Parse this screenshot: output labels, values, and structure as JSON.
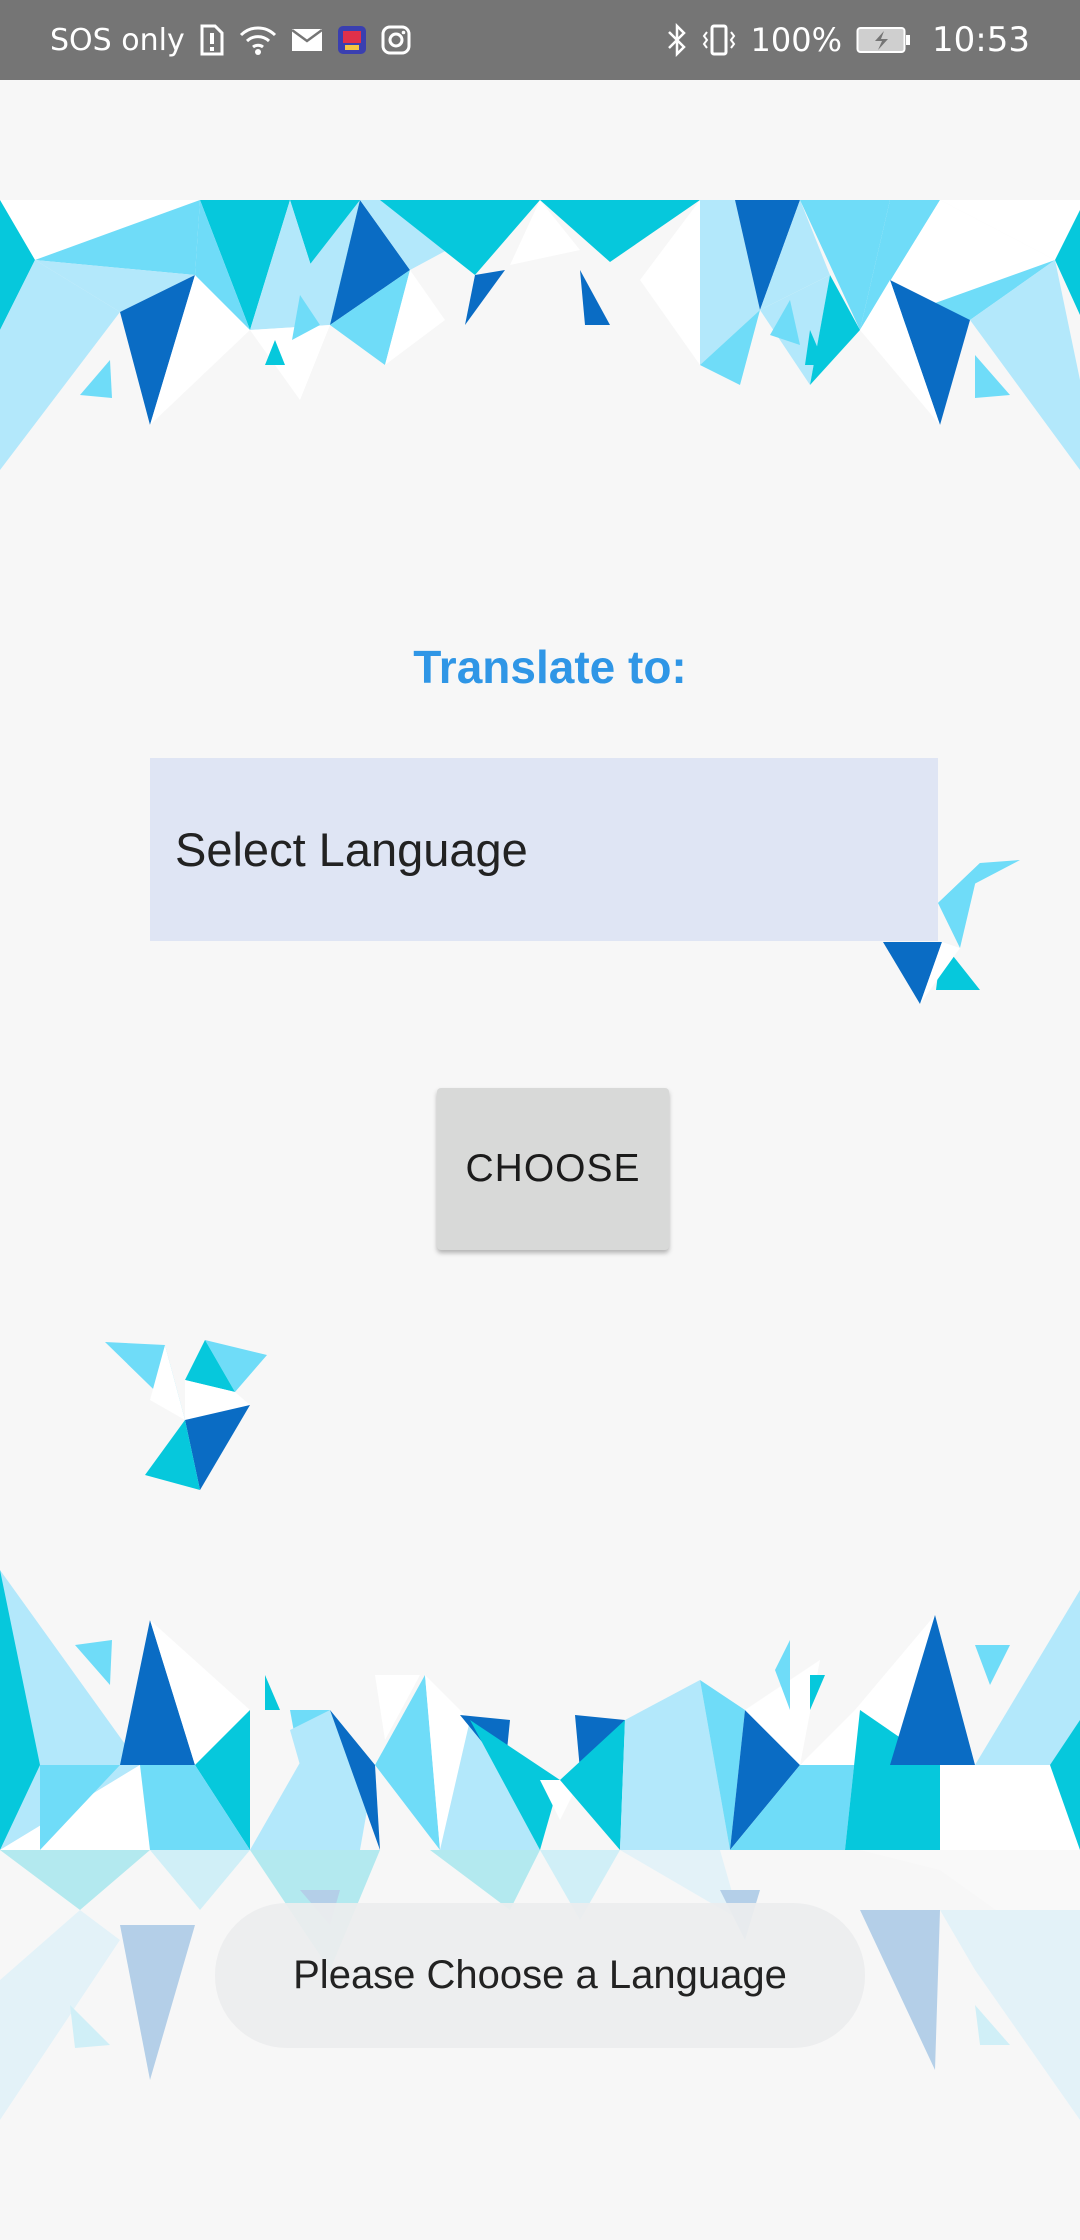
{
  "status_bar": {
    "carrier": "SOS only",
    "battery": "100%",
    "time": "10:53",
    "icons_left": [
      "sim-alert-icon",
      "wifi-icon",
      "mail-icon",
      "app-icon",
      "instagram-icon"
    ],
    "icons_right": [
      "bluetooth-icon",
      "vibrate-icon",
      "battery-charging-icon"
    ]
  },
  "main": {
    "title": "Translate to:",
    "language_select": {
      "selected": "Select Language"
    },
    "choose_button": "CHOOSE"
  },
  "toast": {
    "message": "Please Choose a Language"
  },
  "colors": {
    "title": "#2f96e6",
    "select_background": "#dfe5f4",
    "button_background": "#d8d9d8",
    "status_bar": "#757575",
    "art_dark_blue": "#0a6cc4",
    "art_cyan": "#06c8dc",
    "art_light_blue": "#6fdcf8",
    "art_pale_blue": "#b3e8fb"
  }
}
